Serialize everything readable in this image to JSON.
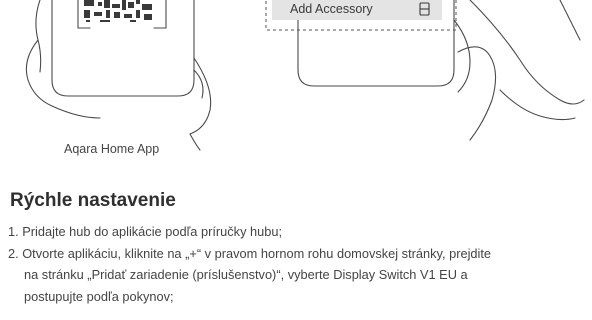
{
  "illustration": {
    "menu_label": "Add Accessory",
    "caption": "Aqara Home App"
  },
  "section": {
    "title": "Rýchle nastavenie",
    "steps": [
      {
        "lines": [
          "1. Pridajte hub do aplikácie podľa príručky hubu;"
        ]
      },
      {
        "lines": [
          "2. Otvorte aplikáciu, kliknite na „+“ v pravom hornom rohu domovskej stránky, prejdite",
          "na stránku „Pridať zariadenie (príslušenstvo)“, vyberte Display Switch V1 EU a",
          "postupujte podľa pokynov;"
        ]
      }
    ]
  }
}
